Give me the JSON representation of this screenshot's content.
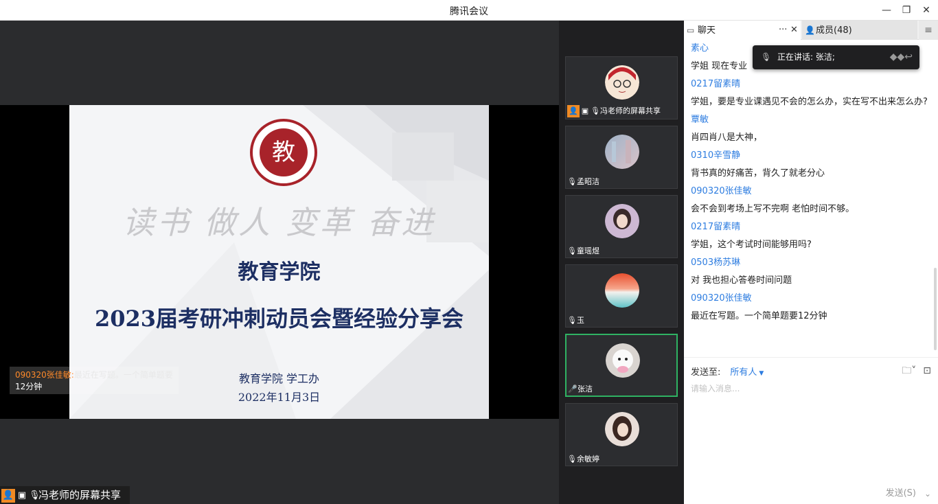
{
  "window": {
    "title": "腾讯会议"
  },
  "slide": {
    "motto": "读书 做人 变革 奋进",
    "department": "教育学院",
    "event_title": "2023届考研冲刺动员会暨经验分享会",
    "office": "教育学院 学工办",
    "date": "2022年11月3日",
    "seal_char": "教"
  },
  "danmu": {
    "sender": "090320张佳敏:",
    "message": "最近在写题。一个简单题要",
    "message_cont": "12分钟"
  },
  "share_label": "冯老师的屏幕共享",
  "participants": [
    {
      "name": "冯老师的屏幕共享",
      "sharing": true
    },
    {
      "name": "孟昭洁"
    },
    {
      "name": "童瑶煜"
    },
    {
      "name": "玉"
    },
    {
      "name": "张洁",
      "active": true
    },
    {
      "name": "余敏婷"
    }
  ],
  "panel": {
    "chat_tab": "聊天",
    "members_tab": "成员(48)",
    "messages": [
      {
        "sender": "素心",
        "text": "学姐 现在专业"
      },
      {
        "sender": "0217留素晴",
        "text": "学姐，要是专业课遇见不会的怎么办，实在写不出来怎么办?"
      },
      {
        "sender": "覃敏",
        "text": "肖四肖八是大神，"
      },
      {
        "sender": "0310辛雪静",
        "text": "背书真的好痛苦，背久了就老分心"
      },
      {
        "sender": "090320张佳敏",
        "text": "会不会到考场上写不完啊 老怕时间不够。"
      },
      {
        "sender": "0217留素晴",
        "text": "学姐，这个考试时间能够用吗?"
      },
      {
        "sender": "0503杨苏琳",
        "text": "对 我也担心答卷时间问题"
      },
      {
        "sender": "090320张佳敏",
        "text": "最近在写题。一个简单题要12分钟"
      }
    ],
    "speaking": "正在讲话: 张洁;",
    "send_to_label": "发送至:",
    "send_to_target": "所有人",
    "input_placeholder": "请输入消息...",
    "send_button": "发送(S)"
  }
}
